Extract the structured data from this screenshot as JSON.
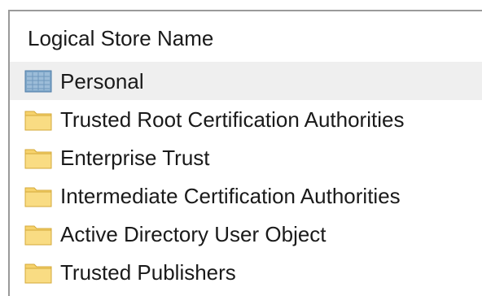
{
  "column_header": "Logical Store Name",
  "stores": [
    {
      "label": "Personal",
      "icon": "certificate-store-icon",
      "selected": true
    },
    {
      "label": "Trusted Root Certification Authorities",
      "icon": "folder-icon",
      "selected": false
    },
    {
      "label": "Enterprise Trust",
      "icon": "folder-icon",
      "selected": false
    },
    {
      "label": "Intermediate Certification Authorities",
      "icon": "folder-icon",
      "selected": false
    },
    {
      "label": "Active Directory User Object",
      "icon": "folder-icon",
      "selected": false
    },
    {
      "label": "Trusted Publishers",
      "icon": "folder-icon",
      "selected": false
    }
  ],
  "colors": {
    "folder": "#f6d26c",
    "folder_edge": "#d4a93a",
    "store_icon": "#7fa7c9",
    "selection": "#efefef"
  }
}
